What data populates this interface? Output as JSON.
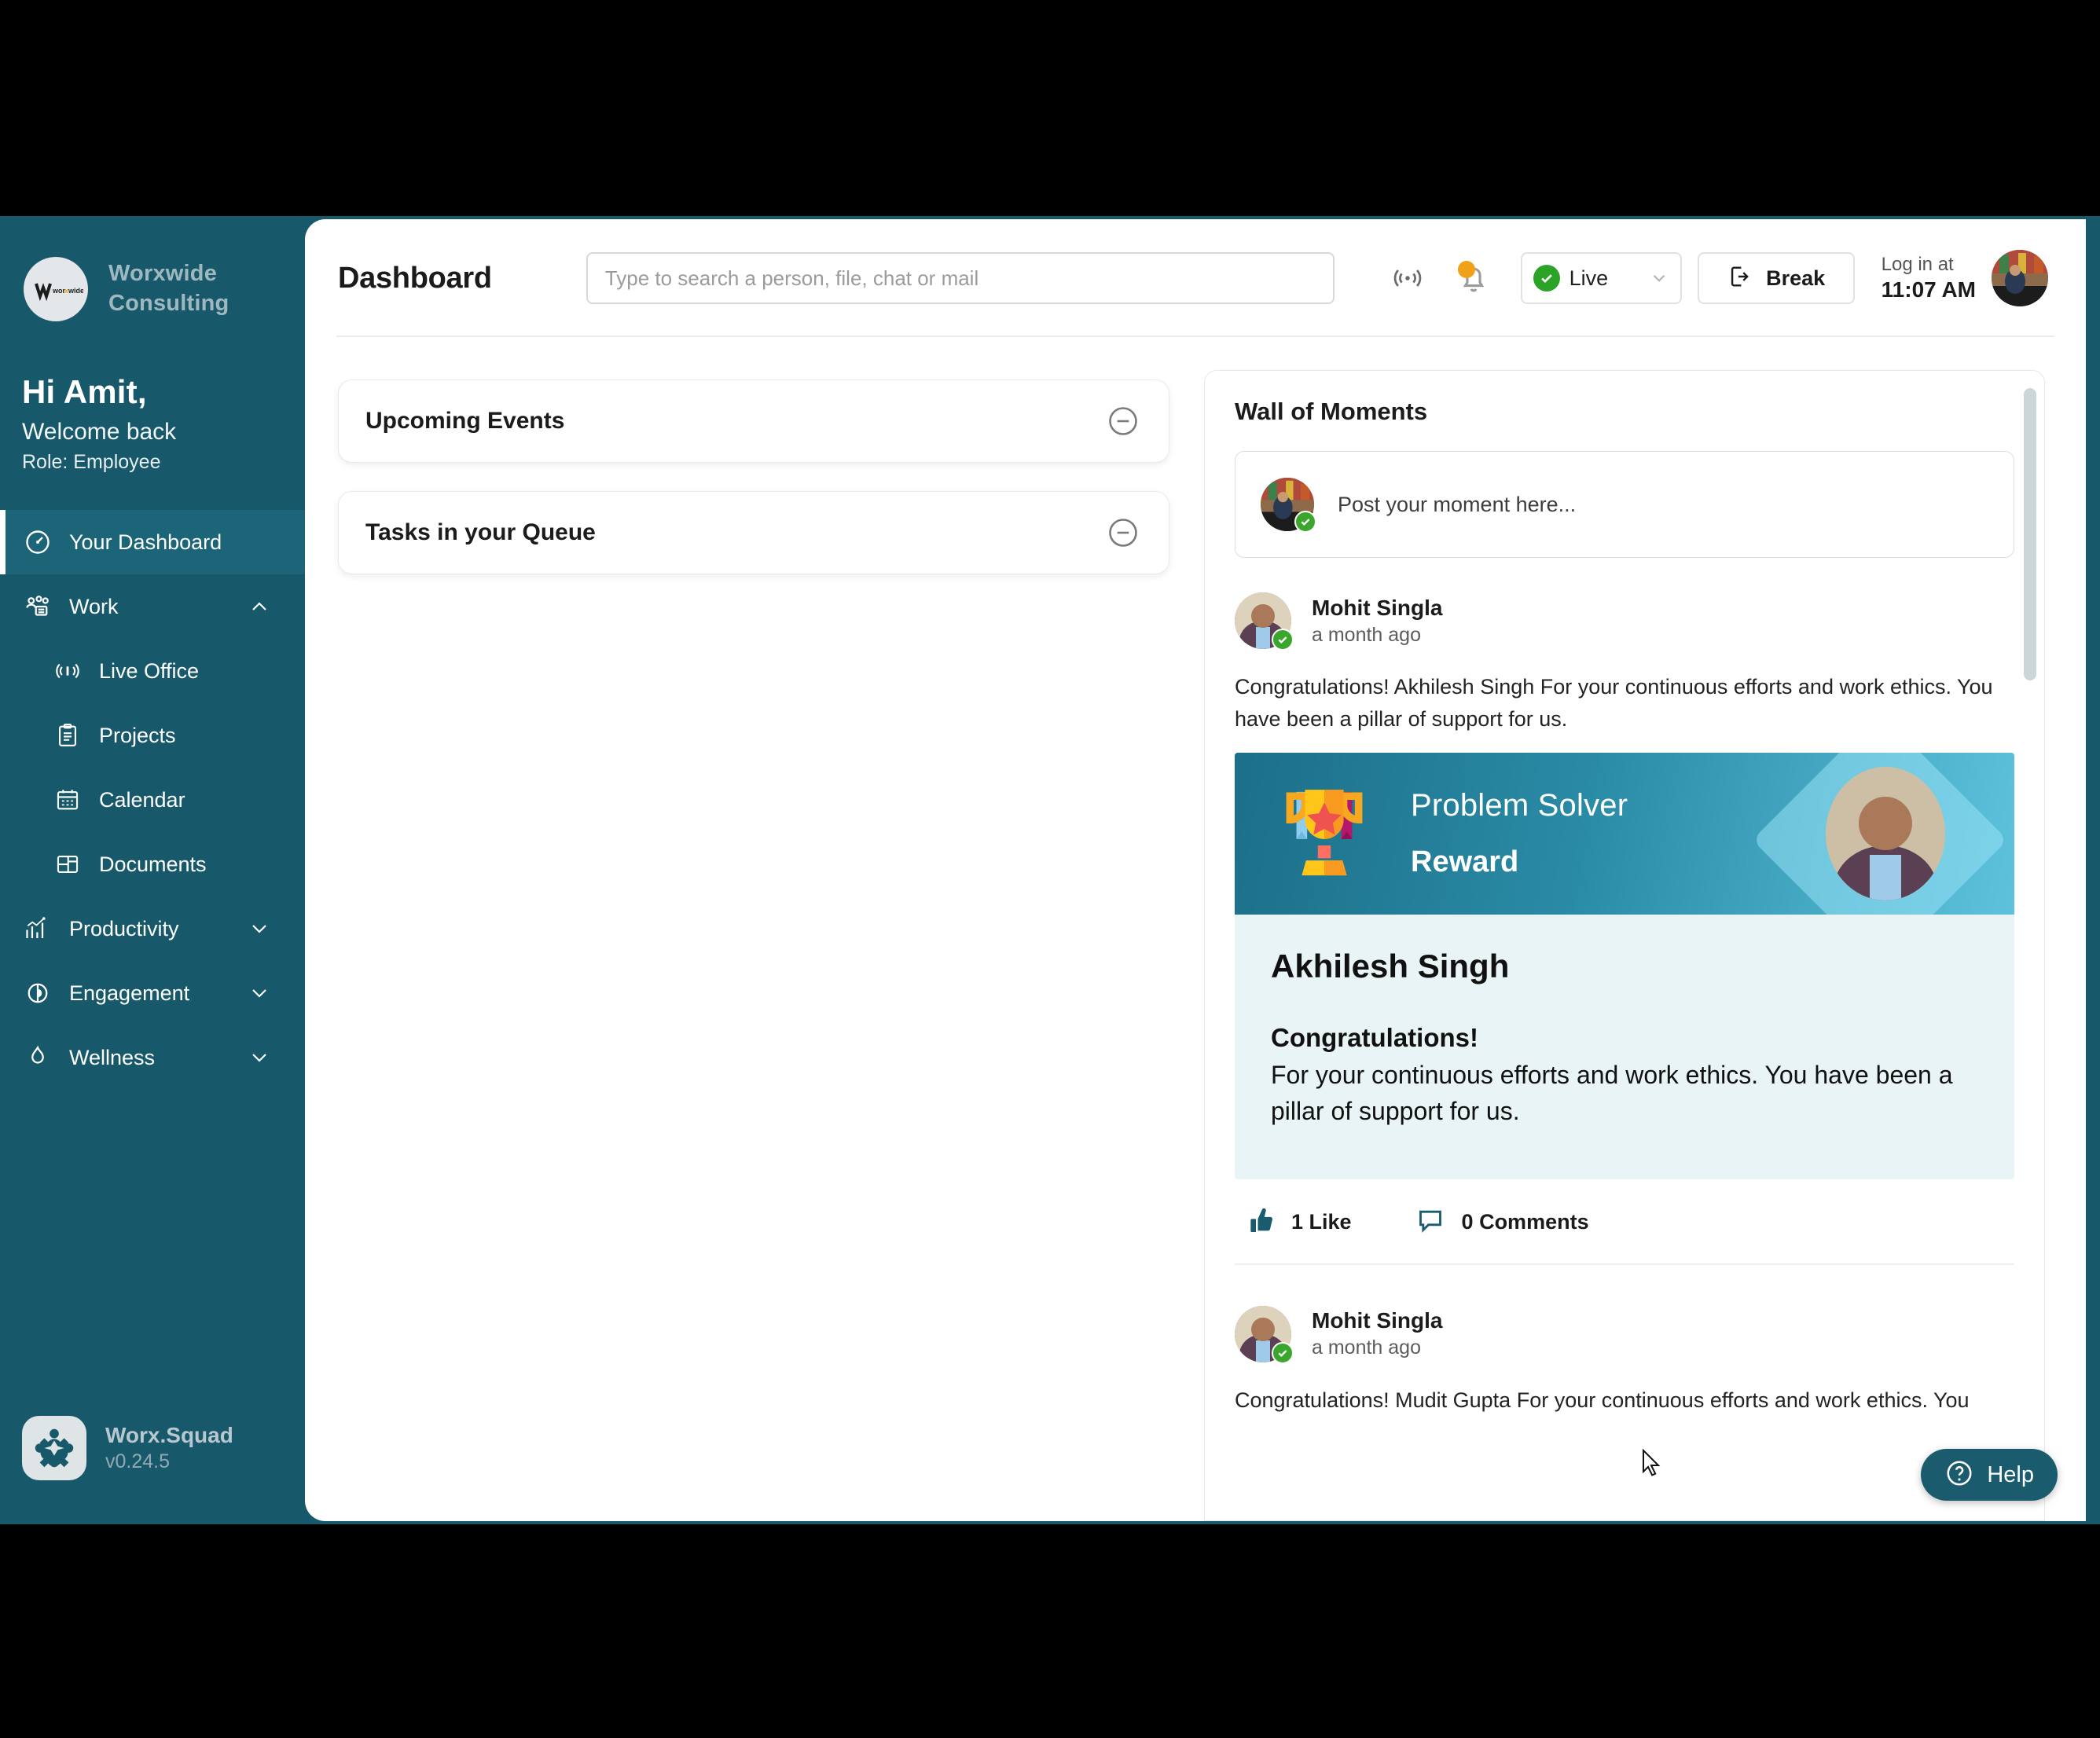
{
  "sidebar": {
    "brand_name": "Worxwide Consulting",
    "brand_logo_text": "worxwide",
    "greeting": "Hi Amit,",
    "welcome": "Welcome back",
    "role": "Role: Employee",
    "items": [
      {
        "label": "Your Dashboard",
        "icon": "gauge-icon",
        "active": true,
        "sub": false,
        "chevron": ""
      },
      {
        "label": "Work",
        "icon": "team-icon",
        "active": false,
        "sub": false,
        "chevron": "up"
      },
      {
        "label": "Live Office",
        "icon": "broadcast-icon",
        "active": false,
        "sub": true,
        "chevron": ""
      },
      {
        "label": "Projects",
        "icon": "clipboard-icon",
        "active": false,
        "sub": true,
        "chevron": ""
      },
      {
        "label": "Calendar",
        "icon": "calendar-icon",
        "active": false,
        "sub": true,
        "chevron": ""
      },
      {
        "label": "Documents",
        "icon": "layout-icon",
        "active": false,
        "sub": true,
        "chevron": ""
      },
      {
        "label": "Productivity",
        "icon": "bar-chart-icon",
        "active": false,
        "sub": false,
        "chevron": "down"
      },
      {
        "label": "Engagement",
        "icon": "pie-leaf-icon",
        "active": false,
        "sub": false,
        "chevron": "down"
      },
      {
        "label": "Wellness",
        "icon": "flame-icon",
        "active": false,
        "sub": false,
        "chevron": "down"
      }
    ],
    "app_name": "Worx.Squad",
    "app_version": "v0.24.5"
  },
  "topbar": {
    "page_title": "Dashboard",
    "search_placeholder": "Type to search a person, file, chat or mail",
    "search_value": "",
    "broadcast_icon": "broadcast-icon",
    "notification_icon": "bell-icon",
    "notification_has_badge": true,
    "status_label": "Live",
    "status_color": "#2aa327",
    "break_label": "Break",
    "login_caption": "Log in at",
    "login_time": "11:07 AM"
  },
  "left_panel": {
    "cards": [
      {
        "title": "Upcoming Events",
        "collapse_icon": "minus-circle-icon"
      },
      {
        "title": "Tasks in your Queue",
        "collapse_icon": "minus-circle-icon"
      }
    ]
  },
  "wall": {
    "title": "Wall of Moments",
    "composer_placeholder": "Post your moment here...",
    "posts": [
      {
        "author": "Mohit Singla",
        "time": "a month ago",
        "text": "Congratulations! Akhilesh Singh For your continuous efforts and work ethics. You have been a pillar of support for us.",
        "award": {
          "kind": "Problem Solver",
          "word": "Reward",
          "name": "Akhilesh Singh",
          "congrats": "Congratulations!",
          "description": "For your continuous efforts and work ethics. You have been a pillar of support for us."
        },
        "likes_label": "1 Like",
        "comments_label": "0 Comments"
      },
      {
        "author": "Mohit Singla",
        "time": "a month ago",
        "text": "Congratulations! Mudit Gupta For your continuous efforts and work ethics. You"
      }
    ]
  },
  "help": {
    "label": "Help",
    "icon": "question-circle-icon"
  }
}
